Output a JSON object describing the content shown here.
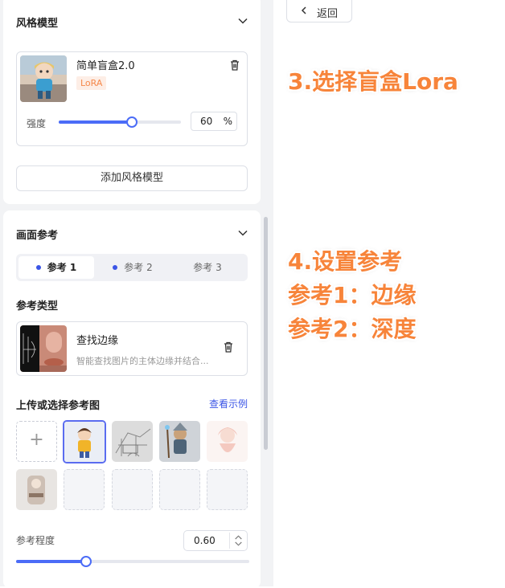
{
  "style_model": {
    "title": "风格模型",
    "model": {
      "name": "简单盲盒2.0",
      "tag": "LoRA",
      "strength_label": "强度",
      "strength_value": "60",
      "strength_unit": "%",
      "strength_fraction": 0.6
    },
    "add_button": "添加风格模型"
  },
  "image_reference": {
    "title": "画面参考",
    "tabs": [
      {
        "label": "参考 1",
        "active": true
      },
      {
        "label": "参考 2",
        "active": false
      },
      {
        "label": "参考 3",
        "active": false
      }
    ],
    "type_title": "参考类型",
    "type": {
      "name": "查找边缘",
      "description": "智能查找图片的主体边缘并结合..."
    },
    "upload_title": "上传或选择参考图",
    "example_link": "查看示例",
    "upload_symbol": "+",
    "degree_label": "参考程度",
    "degree_value": "0.60",
    "degree_fraction": 0.3
  },
  "back_button": "返回",
  "annotations": {
    "step3": "3.选择盲盒Lora",
    "step4_line1": "4.设置参考",
    "step4_line2": "参考1：边缘",
    "step4_line3": "参考2：深度"
  },
  "colors": {
    "accent": "#4b6cf7",
    "annotation": "#f7843a",
    "lora_tag_bg": "#fdeee6",
    "lora_tag_text": "#f5884a"
  },
  "icons": {
    "collapse": "chevron-down-icon",
    "delete": "trash-icon",
    "back": "chevron-left-icon",
    "spinner": "spinner-arrows-icon"
  }
}
